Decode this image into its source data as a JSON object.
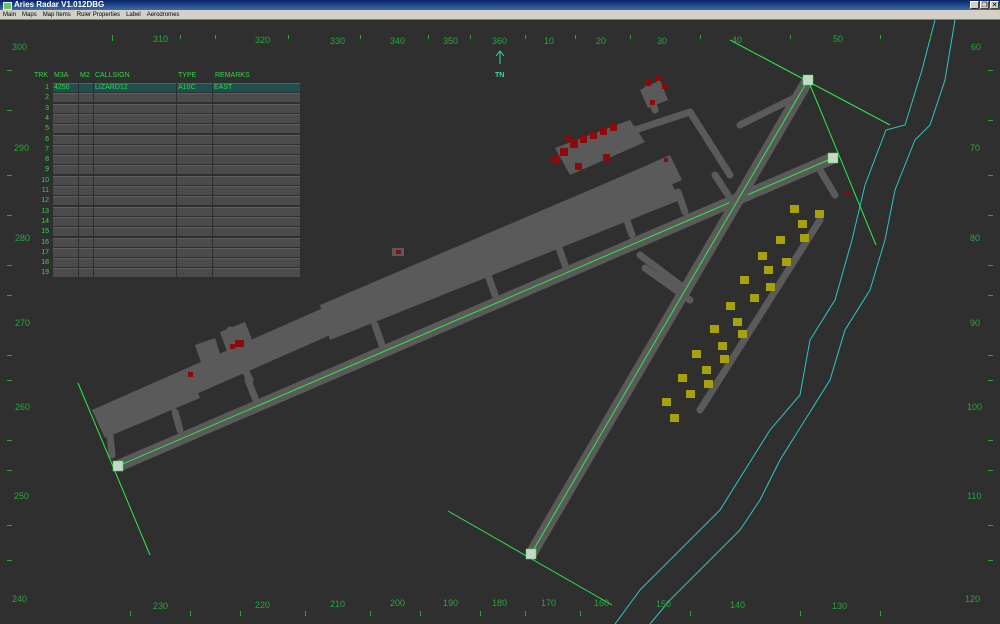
{
  "window": {
    "title": "Aries Radar V1.012DBG",
    "controls": [
      "_",
      "❐",
      "✕"
    ]
  },
  "menu": [
    "Main",
    "Maps",
    "Map Items",
    "Ruler Properties",
    "Label",
    "Aerodromes"
  ],
  "compass": {
    "top": [
      "310",
      "320",
      "330",
      "340",
      "350",
      "360",
      "10",
      "20",
      "30",
      "40",
      "50"
    ],
    "bottom": [
      "230",
      "220",
      "210",
      "200",
      "190",
      "180",
      "170",
      "160",
      "150",
      "140",
      "130"
    ],
    "left": [
      "300",
      "290",
      "280",
      "270",
      "260",
      "250",
      "240"
    ],
    "right": [
      "60",
      "70",
      "80",
      "90",
      "100",
      "110",
      "120"
    ],
    "north_marker": "TN"
  },
  "track_table": {
    "headers": [
      "TRK",
      "M3A",
      "M2",
      "CALLSIGN",
      "TYPE",
      "REMARKS"
    ],
    "rows": [
      {
        "trk": "1",
        "m3a": "4250",
        "m2": "",
        "callsign": "LIZARD12",
        "type": "A10C",
        "remarks": "EAST"
      },
      {
        "trk": "2",
        "m3a": "",
        "m2": "",
        "callsign": "",
        "type": "",
        "remarks": ""
      },
      {
        "trk": "3",
        "m3a": "",
        "m2": "",
        "callsign": "",
        "type": "",
        "remarks": ""
      },
      {
        "trk": "4",
        "m3a": "",
        "m2": "",
        "callsign": "",
        "type": "",
        "remarks": ""
      },
      {
        "trk": "5",
        "m3a": "",
        "m2": "",
        "callsign": "",
        "type": "",
        "remarks": ""
      },
      {
        "trk": "6",
        "m3a": "",
        "m2": "",
        "callsign": "",
        "type": "",
        "remarks": ""
      },
      {
        "trk": "7",
        "m3a": "",
        "m2": "",
        "callsign": "",
        "type": "",
        "remarks": ""
      },
      {
        "trk": "8",
        "m3a": "",
        "m2": "",
        "callsign": "",
        "type": "",
        "remarks": ""
      },
      {
        "trk": "9",
        "m3a": "",
        "m2": "",
        "callsign": "",
        "type": "",
        "remarks": ""
      },
      {
        "trk": "10",
        "m3a": "",
        "m2": "",
        "callsign": "",
        "type": "",
        "remarks": ""
      },
      {
        "trk": "11",
        "m3a": "",
        "m2": "",
        "callsign": "",
        "type": "",
        "remarks": ""
      },
      {
        "trk": "12",
        "m3a": "",
        "m2": "",
        "callsign": "",
        "type": "",
        "remarks": ""
      },
      {
        "trk": "13",
        "m3a": "",
        "m2": "",
        "callsign": "",
        "type": "",
        "remarks": ""
      },
      {
        "trk": "14",
        "m3a": "",
        "m2": "",
        "callsign": "",
        "type": "",
        "remarks": ""
      },
      {
        "trk": "15",
        "m3a": "",
        "m2": "",
        "callsign": "",
        "type": "",
        "remarks": ""
      },
      {
        "trk": "16",
        "m3a": "",
        "m2": "",
        "callsign": "",
        "type": "",
        "remarks": ""
      },
      {
        "trk": "17",
        "m3a": "",
        "m2": "",
        "callsign": "",
        "type": "",
        "remarks": ""
      },
      {
        "trk": "18",
        "m3a": "",
        "m2": "",
        "callsign": "",
        "type": "",
        "remarks": ""
      },
      {
        "trk": "19",
        "m3a": "",
        "m2": "",
        "callsign": "",
        "type": "",
        "remarks": ""
      }
    ]
  },
  "colors": {
    "background": "#2f2f2f",
    "text_green": "#33d649",
    "compass_green": "#25a83a",
    "runway_centerline": "#2ee84a",
    "coastline": "#2bc7c7",
    "taxiway": "#5a5a5a",
    "building_red": "#8b0a0a",
    "hardstand_yellow": "#a8a10e",
    "selected_row": "#1f4f4f"
  }
}
